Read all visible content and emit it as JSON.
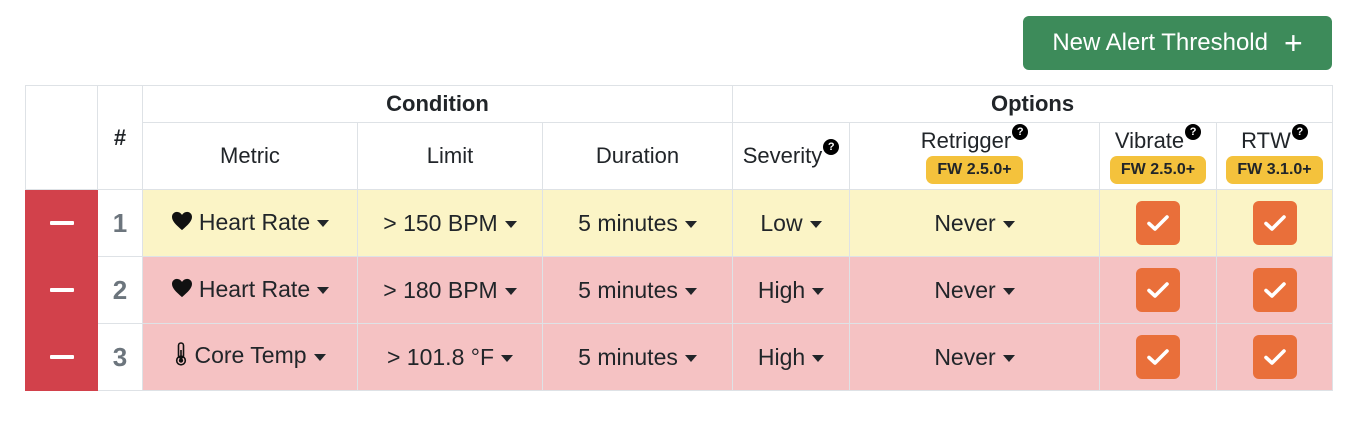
{
  "toolbar": {
    "new_button_label": "New Alert Threshold",
    "new_button_icon": "plus-icon"
  },
  "table": {
    "group_headers": {
      "condition": "Condition",
      "options": "Options"
    },
    "hash_header": "#",
    "columns": {
      "metric": "Metric",
      "limit": "Limit",
      "duration": "Duration",
      "severity": "Severity",
      "retrigger": "Retrigger",
      "vibrate": "Vibrate",
      "rtw": "RTW"
    },
    "help_mark": "?",
    "badges": {
      "retrigger": "FW 2.5.0+",
      "vibrate": "FW 2.5.0+",
      "rtw": "FW 3.1.0+"
    },
    "rows": [
      {
        "num": "1",
        "metric_icon": "heart-icon",
        "metric": "Heart Rate",
        "limit": "> 150 BPM",
        "duration": "5 minutes",
        "severity": "Low",
        "retrigger": "Never",
        "vibrate": true,
        "rtw": true,
        "row_color": "#fbf4c6"
      },
      {
        "num": "2",
        "metric_icon": "heart-icon",
        "metric": "Heart Rate",
        "limit": "> 180 BPM",
        "duration": "5 minutes",
        "severity": "High",
        "retrigger": "Never",
        "vibrate": true,
        "rtw": true,
        "row_color": "#f5c2c3"
      },
      {
        "num": "3",
        "metric_icon": "thermometer-icon",
        "metric": "Core Temp",
        "limit": "> 101.8 °F",
        "duration": "5 minutes",
        "severity": "High",
        "retrigger": "Never",
        "vibrate": true,
        "rtw": true,
        "row_color": "#f5c2c3"
      }
    ]
  },
  "colors": {
    "add_button": "#3d8b5a",
    "delete_button": "#d2414b",
    "checkbox": "#e96f3a",
    "badge": "#f4c23c"
  }
}
